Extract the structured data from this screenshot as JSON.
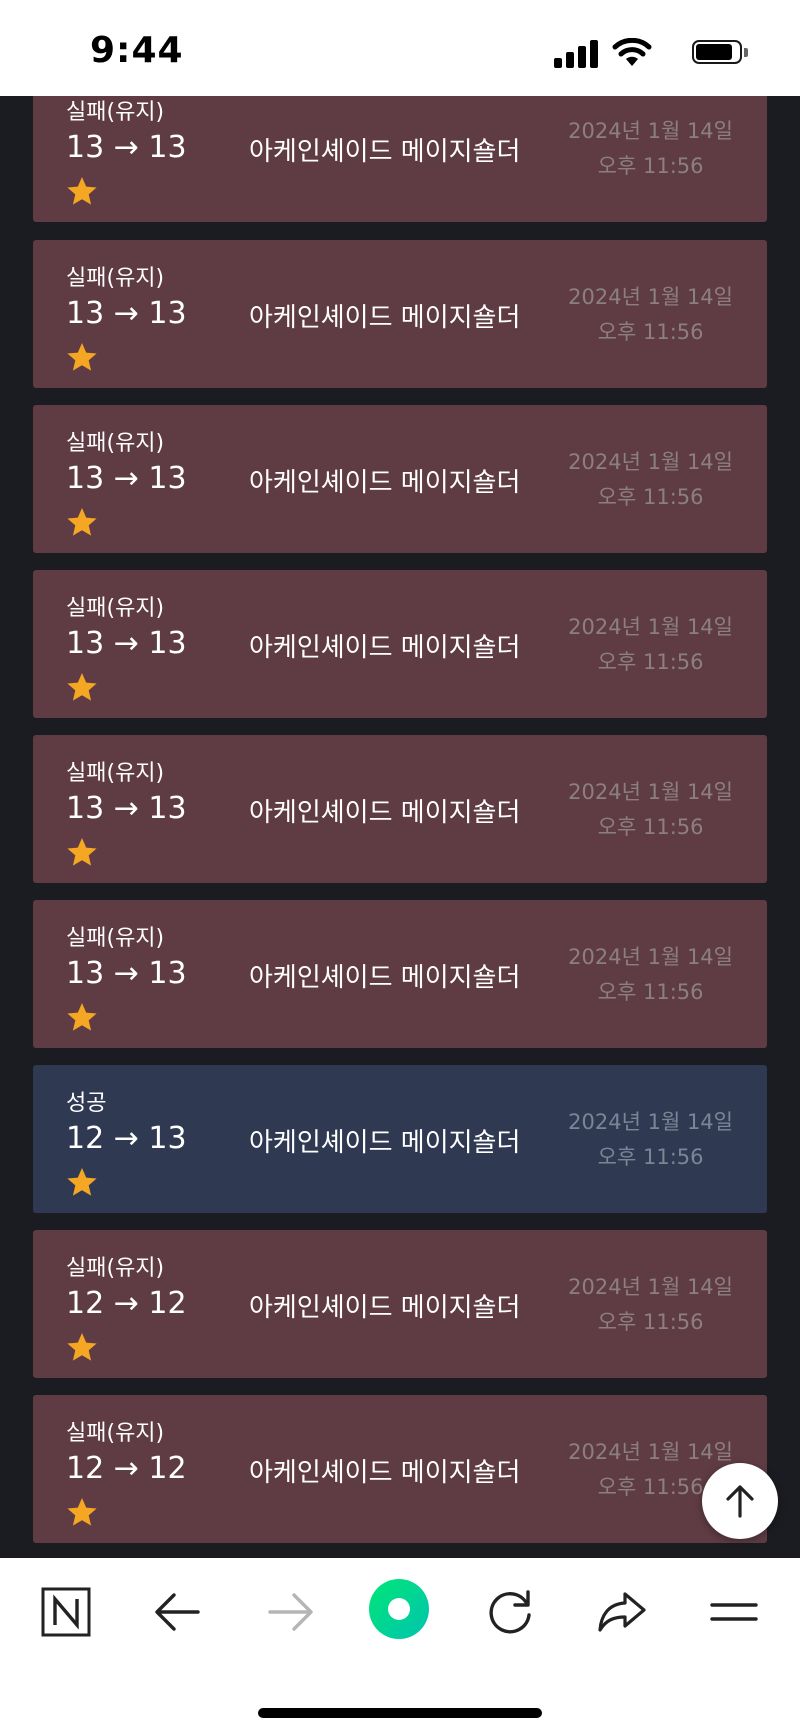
{
  "status_bar": {
    "time": "9:44"
  },
  "colors": {
    "fail_card": "#5f3c44",
    "success_card": "#2f3a52",
    "star": "#f5a623",
    "background": "#1b1c21",
    "naver_green": "#03cf5d"
  },
  "records": [
    {
      "result": "실패(유지)",
      "levels": "13 → 13",
      "item": "아케인셰이드 메이지숄더",
      "date": "2024년 1월 14일",
      "time": "오후 11:56",
      "stars": 1,
      "status": "fail"
    },
    {
      "result": "실패(유지)",
      "levels": "13 → 13",
      "item": "아케인셰이드 메이지숄더",
      "date": "2024년 1월 14일",
      "time": "오후 11:56",
      "stars": 1,
      "status": "fail"
    },
    {
      "result": "실패(유지)",
      "levels": "13 → 13",
      "item": "아케인셰이드 메이지숄더",
      "date": "2024년 1월 14일",
      "time": "오후 11:56",
      "stars": 1,
      "status": "fail"
    },
    {
      "result": "실패(유지)",
      "levels": "13 → 13",
      "item": "아케인셰이드 메이지숄더",
      "date": "2024년 1월 14일",
      "time": "오후 11:56",
      "stars": 1,
      "status": "fail"
    },
    {
      "result": "실패(유지)",
      "levels": "13 → 13",
      "item": "아케인셰이드 메이지숄더",
      "date": "2024년 1월 14일",
      "time": "오후 11:56",
      "stars": 1,
      "status": "fail"
    },
    {
      "result": "실패(유지)",
      "levels": "13 → 13",
      "item": "아케인셰이드 메이지숄더",
      "date": "2024년 1월 14일",
      "time": "오후 11:56",
      "stars": 1,
      "status": "fail"
    },
    {
      "result": "성공",
      "levels": "12 → 13",
      "item": "아케인셰이드 메이지숄더",
      "date": "2024년 1월 14일",
      "time": "오후 11:56",
      "stars": 1,
      "status": "success"
    },
    {
      "result": "실패(유지)",
      "levels": "12 → 12",
      "item": "아케인셰이드 메이지숄더",
      "date": "2024년 1월 14일",
      "time": "오후 11:56",
      "stars": 1,
      "status": "fail"
    },
    {
      "result": "실패(유지)",
      "levels": "12 → 12",
      "item": "아케인셰이드 메이지숄더",
      "date": "2024년 1월 14일",
      "time": "오후 11:56",
      "stars": 1,
      "status": "fail"
    }
  ],
  "toolbar": {
    "buttons": [
      {
        "icon": "naver-n-icon"
      },
      {
        "icon": "back-arrow-icon"
      },
      {
        "icon": "forward-arrow-icon"
      },
      {
        "icon": "green-dot-icon"
      },
      {
        "icon": "reload-icon"
      },
      {
        "icon": "share-icon"
      },
      {
        "icon": "menu-icon"
      }
    ]
  },
  "scroll_top": {
    "icon": "arrow-up-icon"
  }
}
